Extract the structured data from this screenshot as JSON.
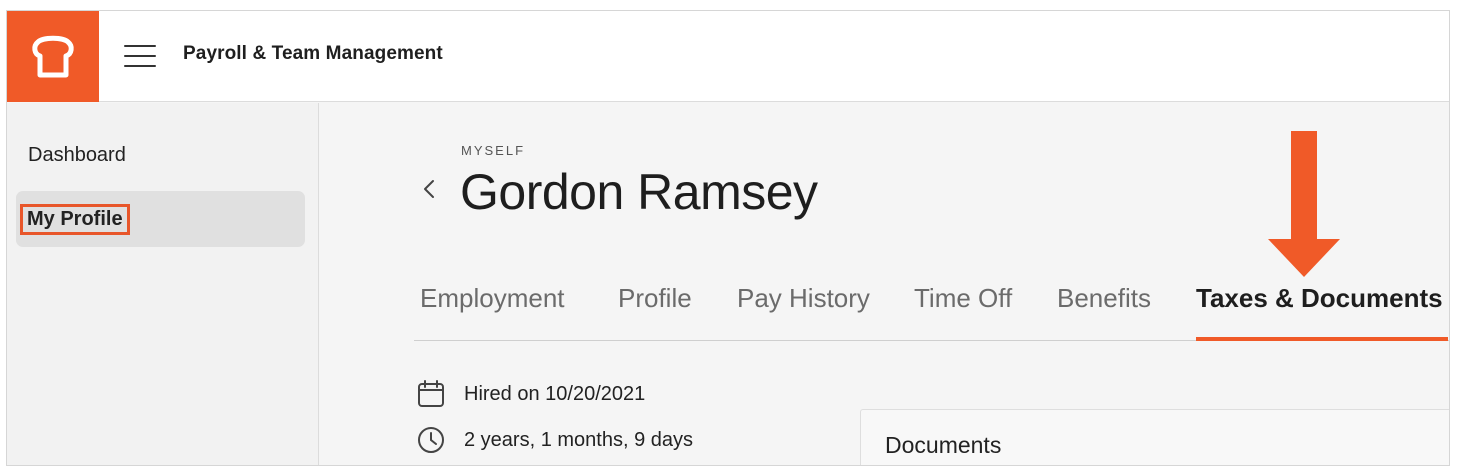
{
  "header": {
    "app_title": "Payroll & Team Management",
    "brand_color": "#f05a28"
  },
  "sidebar": {
    "items": [
      {
        "label": "Dashboard"
      },
      {
        "label": "My Profile",
        "active": true
      }
    ]
  },
  "profile": {
    "eyebrow": "MYSELF",
    "name": "Gordon Ramsey"
  },
  "tabs": [
    {
      "label": "Employment"
    },
    {
      "label": "Profile"
    },
    {
      "label": "Pay History"
    },
    {
      "label": "Time Off"
    },
    {
      "label": "Benefits"
    },
    {
      "label": "Taxes & Documents",
      "active": true
    }
  ],
  "details": {
    "hired": "Hired on 10/20/2021",
    "tenure": "2 years, 1 months, 9 days"
  },
  "documents": {
    "title": "Documents"
  },
  "icons": [
    "menu-icon",
    "toast-logo-icon",
    "chevron-left-icon",
    "calendar-icon",
    "clock-icon",
    "arrow-down-icon"
  ]
}
